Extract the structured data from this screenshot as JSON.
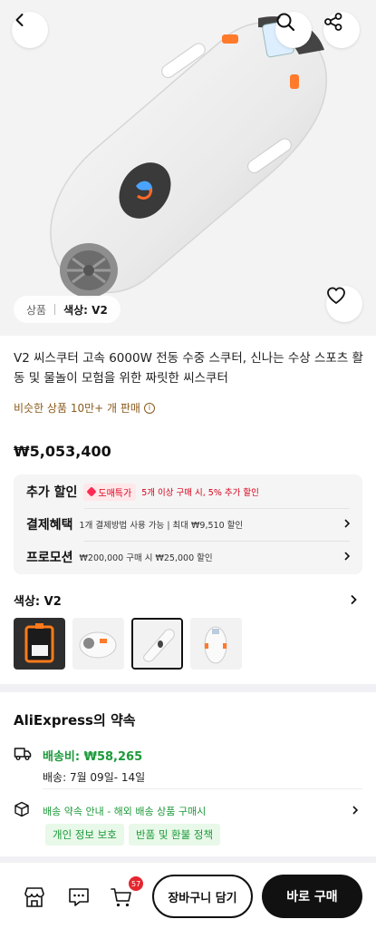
{
  "hero": {
    "tag_left": "상품",
    "tag_right": "색상: V2"
  },
  "product": {
    "title": "V2 씨스쿠터 고속 6000W 전동 수중 스쿠터, 신나는 수상 스포츠 활동 및 물놀이 모험을 위한 짜릿한 씨스쿠터",
    "sold": "비슷한 상품 10만+ 개 판매",
    "price": "₩5,053,400"
  },
  "promos": [
    {
      "label": "추가 할인",
      "badge": "도매특가",
      "text": "5개 이상 구매 시, 5% 추가 할인"
    },
    {
      "label": "결제혜택",
      "text": "1개 결제방법 사용 가능 | 최대 ₩9,510 할인"
    },
    {
      "label": "프로모션",
      "text": "₩200,000 구매 시 ₩25,000 할인"
    }
  ],
  "color": {
    "heading": "색상: V2"
  },
  "promise": {
    "title": "AliExpress의 약속",
    "shipping_fee": "배송비: ₩58,265",
    "shipping_date": "배송: 7월 09일- 14일",
    "pledge": "배송 약속 안내 - 해외 배송 상품 구매시",
    "chips": [
      "개인 정보 보호",
      "반품 및 환불 정책"
    ]
  },
  "bottom": {
    "cart_count": "57",
    "add_to_cart": "장바구니 담기",
    "buy_now": "바로 구매"
  },
  "colors": {
    "green": "#1d9a3a",
    "red": "#d9001b",
    "dark": "#111111"
  }
}
